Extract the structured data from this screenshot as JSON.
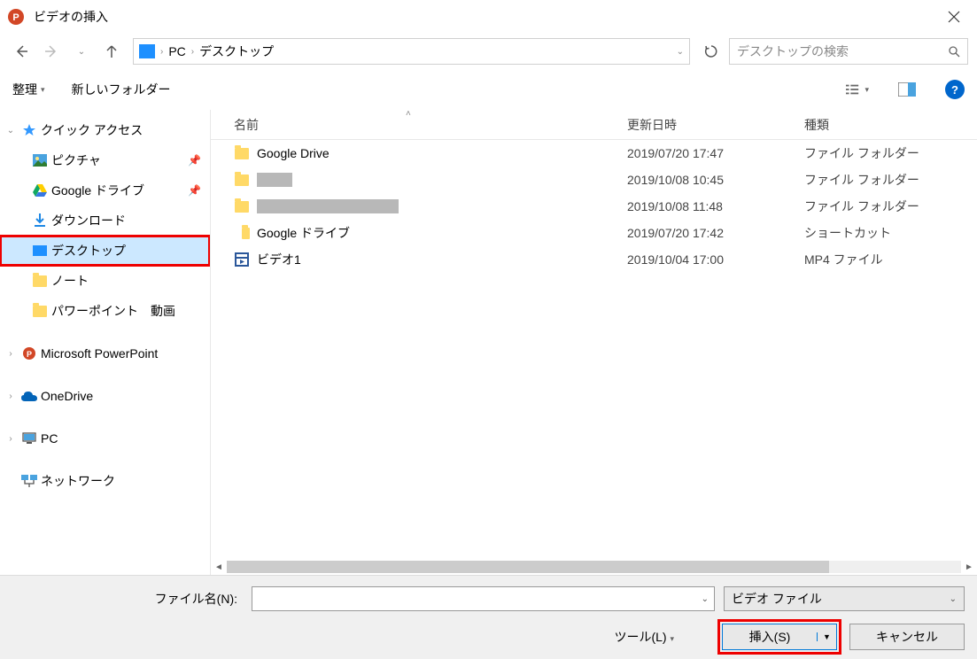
{
  "titlebar": {
    "title": "ビデオの挿入"
  },
  "breadcrumb": {
    "seg1": "PC",
    "seg2": "デスクトップ"
  },
  "search": {
    "placeholder": "デスクトップの検索"
  },
  "toolbar": {
    "organize": "整理",
    "new_folder": "新しいフォルダー"
  },
  "tree": {
    "quick_access": "クイック アクセス",
    "pictures": "ピクチャ",
    "gdrive": "Google ドライブ",
    "downloads": "ダウンロード",
    "desktop": "デスクトップ",
    "notes": "ノート",
    "ppt_video": "パワーポイント　動画",
    "ms_ppt": "Microsoft PowerPoint",
    "onedrive": "OneDrive",
    "pc": "PC",
    "network": "ネットワーク"
  },
  "headers": {
    "name": "名前",
    "date": "更新日時",
    "type": "種類"
  },
  "files": [
    {
      "name": "Google Drive",
      "date": "2019/07/20 17:47",
      "type": "ファイル フォルダー",
      "icon": "folder"
    },
    {
      "name": "",
      "date": "2019/10/08 10:45",
      "type": "ファイル フォルダー",
      "icon": "folder",
      "gray": 40
    },
    {
      "name": "",
      "date": "2019/10/08 11:48",
      "type": "ファイル フォルダー",
      "icon": "folder",
      "gray": 160
    },
    {
      "name": "Google ドライブ",
      "date": "2019/07/20 17:42",
      "type": "ショートカット",
      "icon": "shortcut"
    },
    {
      "name": "ビデオ1",
      "date": "2019/10/04 17:00",
      "type": "MP4 ファイル",
      "icon": "video"
    }
  ],
  "bottom": {
    "filename_label": "ファイル名(N):",
    "filter": "ビデオ ファイル",
    "tools": "ツール(L)",
    "insert": "挿入(S)",
    "cancel": "キャンセル"
  }
}
